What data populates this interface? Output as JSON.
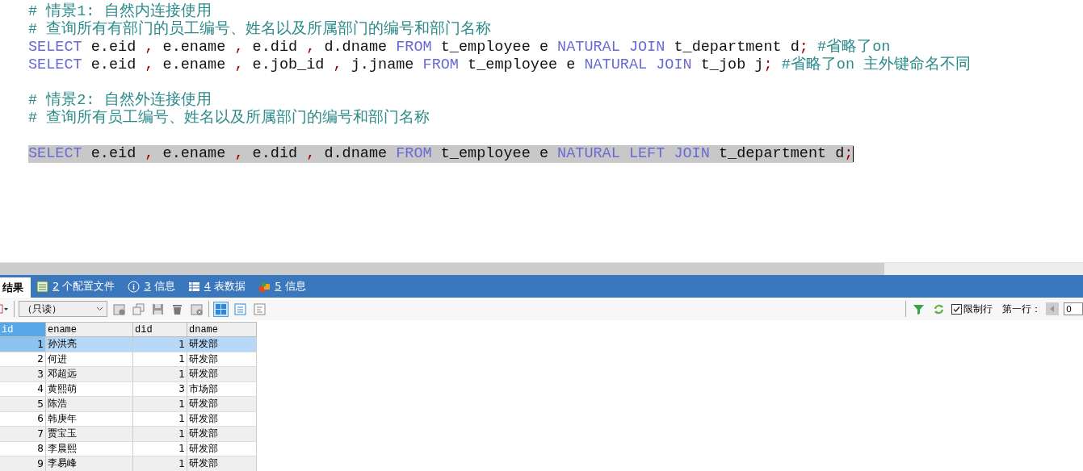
{
  "editor": {
    "lines": [
      {
        "kind": "code",
        "selected": false,
        "tokens": [
          {
            "kind": "comment",
            "text": "# 情景1: 自然内连接使用"
          }
        ]
      },
      {
        "kind": "code",
        "selected": false,
        "tokens": [
          {
            "kind": "comment",
            "text": "# 查询所有有部门的员工编号、姓名以及所属部门的编号和部门名称"
          }
        ]
      },
      {
        "kind": "code",
        "selected": false,
        "tokens": [
          {
            "kind": "keyword",
            "text": "SELECT"
          },
          {
            "kind": "plain",
            "text": " e.eid "
          },
          {
            "kind": "punct",
            "text": ","
          },
          {
            "kind": "plain",
            "text": " e.ename "
          },
          {
            "kind": "punct",
            "text": ","
          },
          {
            "kind": "plain",
            "text": " e.did "
          },
          {
            "kind": "punct",
            "text": ","
          },
          {
            "kind": "plain",
            "text": " d.dname "
          },
          {
            "kind": "keyword",
            "text": "FROM"
          },
          {
            "kind": "plain",
            "text": " t_employee e "
          },
          {
            "kind": "keyword",
            "text": "NATURAL JOIN"
          },
          {
            "kind": "plain",
            "text": " t_department d"
          },
          {
            "kind": "punct",
            "text": ";"
          },
          {
            "kind": "comment",
            "text": "#省略了on"
          }
        ]
      },
      {
        "kind": "code",
        "selected": false,
        "tokens": [
          {
            "kind": "keyword",
            "text": "SELECT"
          },
          {
            "kind": "plain",
            "text": " e.eid "
          },
          {
            "kind": "punct",
            "text": ","
          },
          {
            "kind": "plain",
            "text": " e.ename "
          },
          {
            "kind": "punct",
            "text": ","
          },
          {
            "kind": "plain",
            "text": " e.job_id "
          },
          {
            "kind": "punct",
            "text": ","
          },
          {
            "kind": "plain",
            "text": " j.jname "
          },
          {
            "kind": "keyword",
            "text": "FROM"
          },
          {
            "kind": "plain",
            "text": " t_employee e "
          },
          {
            "kind": "keyword",
            "text": "NATURAL JOIN"
          },
          {
            "kind": "plain",
            "text": " t_job j"
          },
          {
            "kind": "punct",
            "text": ";"
          },
          {
            "kind": "comment",
            "text": "#省略了on 主外键命名不同"
          }
        ]
      },
      {
        "kind": "blank",
        "selected": false
      },
      {
        "kind": "code",
        "selected": false,
        "tokens": [
          {
            "kind": "comment",
            "text": "# 情景2: 自然外连接使用"
          }
        ]
      },
      {
        "kind": "code",
        "selected": false,
        "tokens": [
          {
            "kind": "comment",
            "text": "# 查询所有员工编号、姓名以及所属部门的编号和部门名称"
          }
        ]
      },
      {
        "kind": "blank",
        "selected": false
      },
      {
        "kind": "code",
        "selected": true,
        "tokens": [
          {
            "kind": "keyword",
            "text": "SELECT"
          },
          {
            "kind": "plain",
            "text": " e.eid "
          },
          {
            "kind": "punct",
            "text": ","
          },
          {
            "kind": "plain",
            "text": " e.ename "
          },
          {
            "kind": "punct",
            "text": ","
          },
          {
            "kind": "plain",
            "text": " e.did "
          },
          {
            "kind": "punct",
            "text": ","
          },
          {
            "kind": "plain",
            "text": " d.dname "
          },
          {
            "kind": "keyword",
            "text": "FROM"
          },
          {
            "kind": "plain",
            "text": " t_employee e "
          },
          {
            "kind": "keyword",
            "text": "NATURAL LEFT JOIN"
          },
          {
            "kind": "plain",
            "text": " t_department d"
          },
          {
            "kind": "punct",
            "text": ";"
          }
        ]
      }
    ]
  },
  "result_tabs": [
    {
      "kind": "results",
      "label": "结果",
      "selected": true
    },
    {
      "kind": "profiles",
      "number": "2",
      "label": " 个配置文件",
      "selected": false
    },
    {
      "kind": "messages",
      "number": "3",
      "label": " 信息",
      "selected": false
    },
    {
      "kind": "tabledata",
      "number": "4",
      "label": " 表数据",
      "selected": false
    },
    {
      "kind": "info",
      "number": "5",
      "label": " 信息",
      "selected": false
    }
  ],
  "toolbar": {
    "mode_select": {
      "value": "（只读）"
    },
    "view_buttons": [
      {
        "kind": "grid",
        "selected": true
      },
      {
        "kind": "form",
        "selected": false
      },
      {
        "kind": "text",
        "selected": false
      }
    ],
    "limit_rows": {
      "label": "限制行",
      "checked": true
    },
    "first_row": {
      "label": "第一行：",
      "value": "0"
    }
  },
  "grid": {
    "columns": [
      {
        "label": "id",
        "selected": true
      },
      {
        "label": "ename",
        "selected": false
      },
      {
        "label": "did",
        "selected": false
      },
      {
        "label": "dname",
        "selected": false
      }
    ],
    "rows": [
      {
        "cells": [
          "1",
          "孙洪亮",
          "1",
          "研发部"
        ],
        "selected": true
      },
      {
        "cells": [
          "2",
          "何进",
          "1",
          "研发部"
        ],
        "selected": false
      },
      {
        "cells": [
          "3",
          "邓超远",
          "1",
          "研发部"
        ],
        "selected": false
      },
      {
        "cells": [
          "4",
          "黄熙萌",
          "3",
          "市场部"
        ],
        "selected": false
      },
      {
        "cells": [
          "5",
          "陈浩",
          "1",
          "研发部"
        ],
        "selected": false
      },
      {
        "cells": [
          "6",
          "韩庚年",
          "1",
          "研发部"
        ],
        "selected": false
      },
      {
        "cells": [
          "7",
          "贾宝玉",
          "1",
          "研发部"
        ],
        "selected": false
      },
      {
        "cells": [
          "8",
          "李晨熙",
          "1",
          "研发部"
        ],
        "selected": false
      },
      {
        "cells": [
          "9",
          "李易峰",
          "1",
          "研发部"
        ],
        "selected": false
      }
    ]
  }
}
